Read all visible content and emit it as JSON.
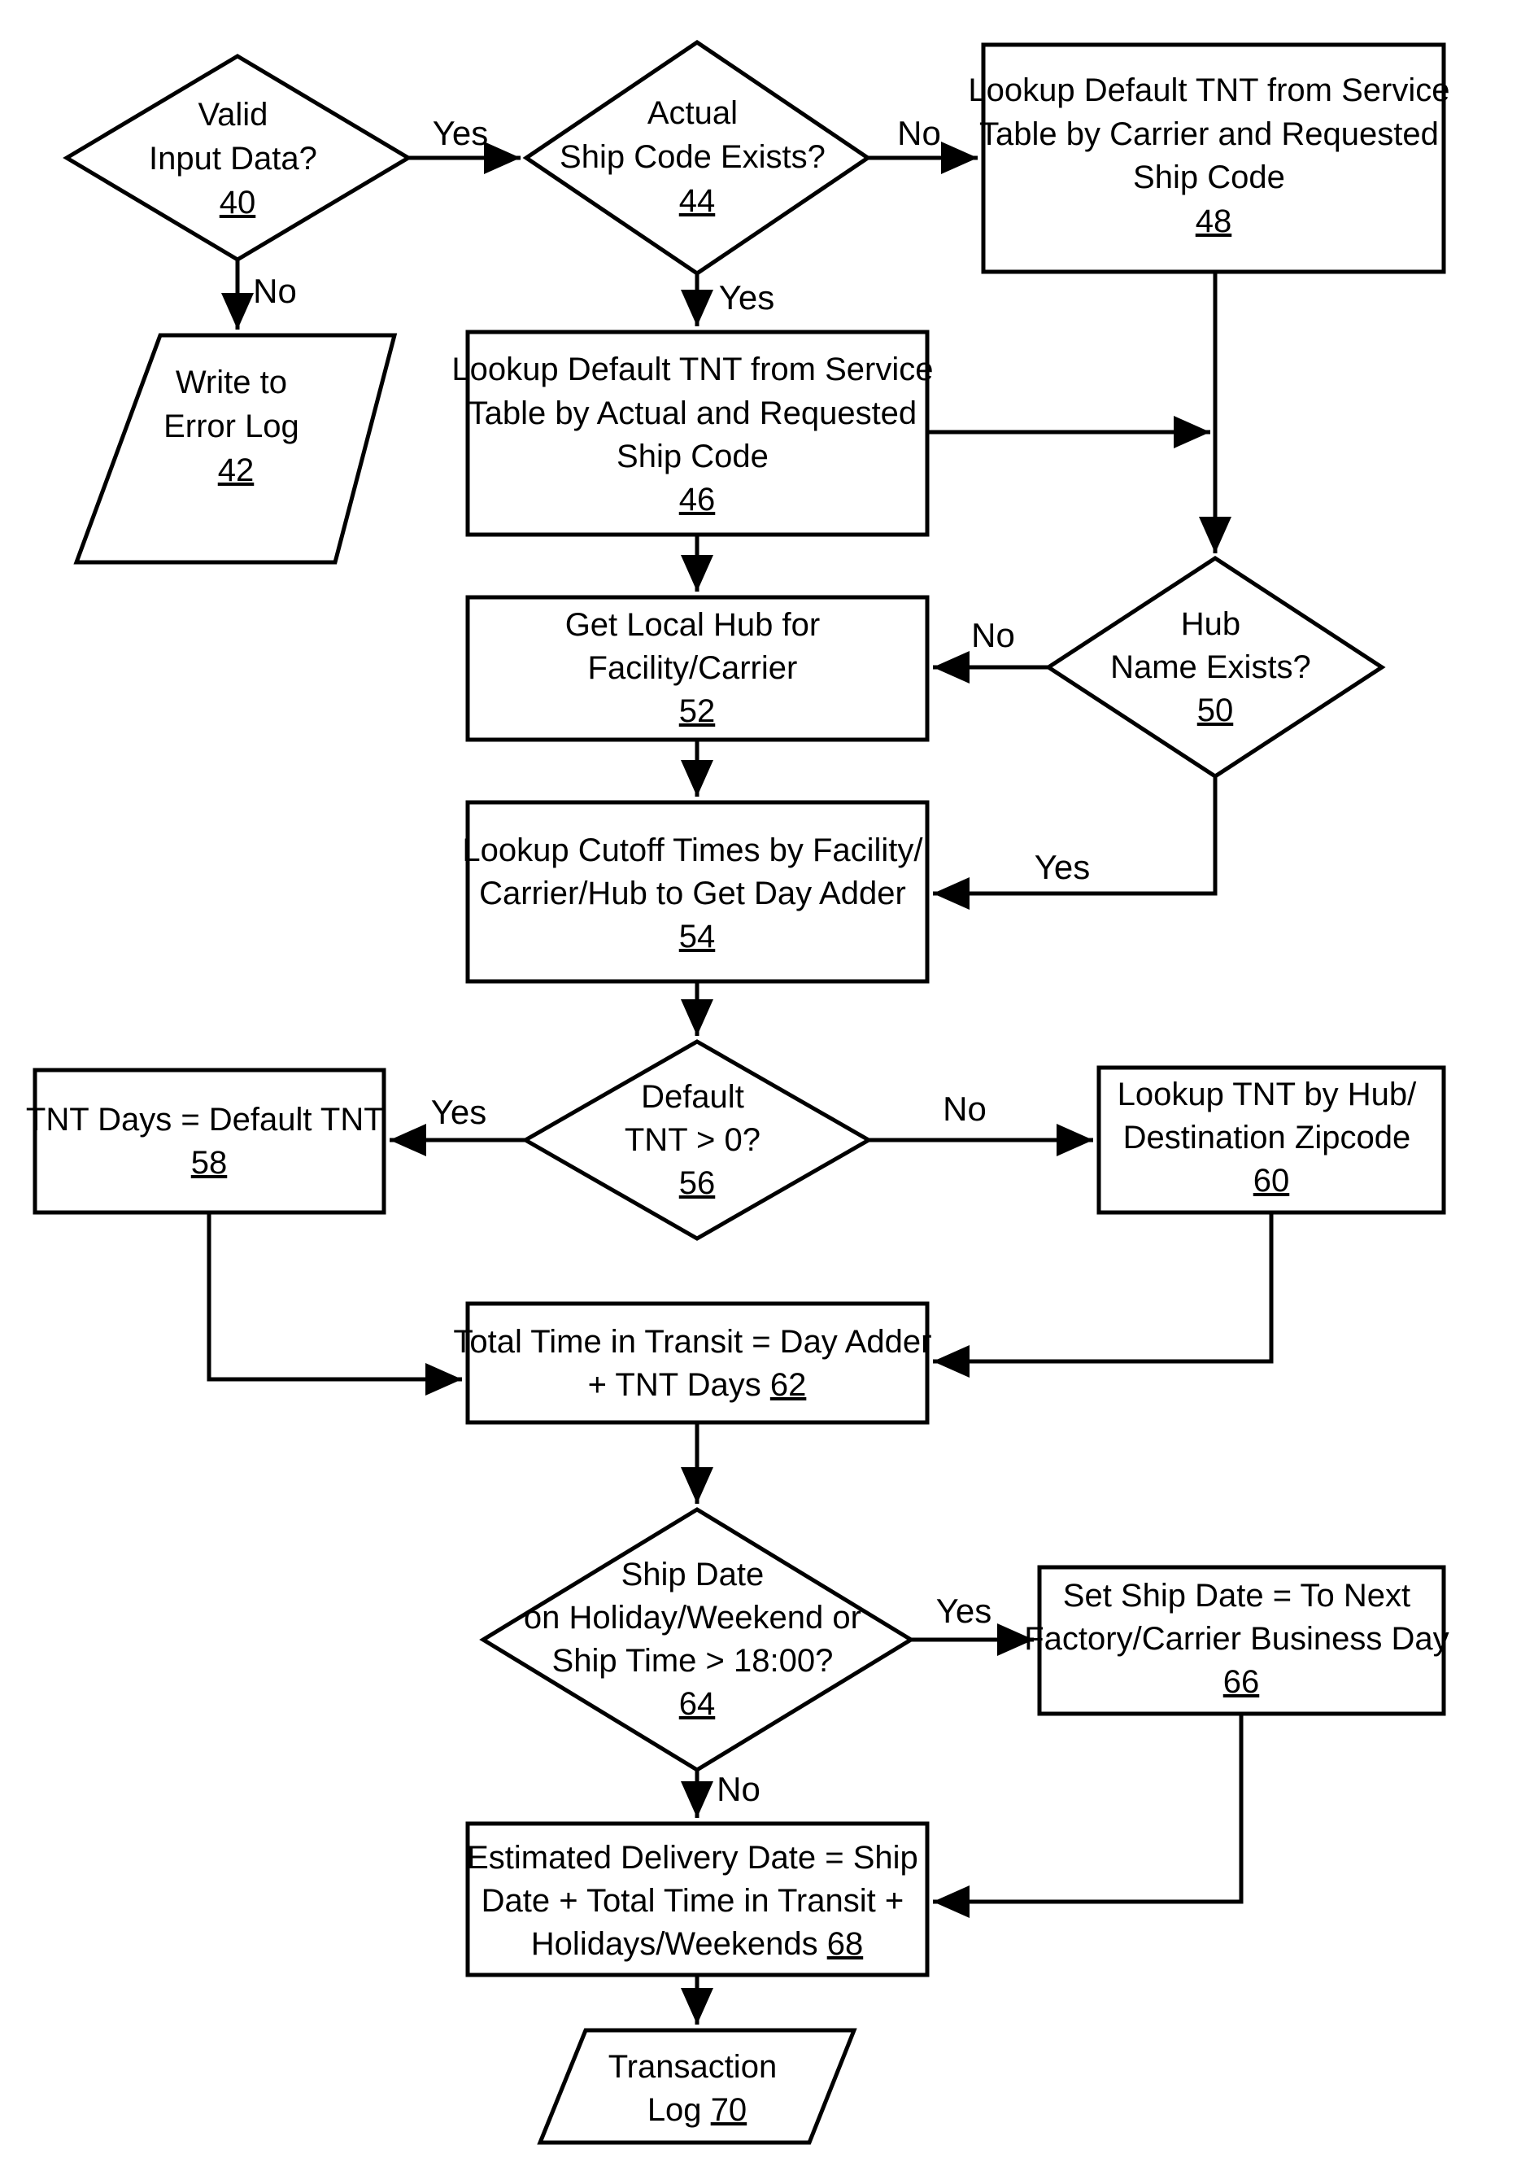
{
  "diagram": {
    "type": "flowchart",
    "nodes": {
      "n40": {
        "shape": "decision",
        "lines": [
          "Valid",
          "Input Data?"
        ],
        "ref": "40"
      },
      "n42": {
        "shape": "io",
        "lines": [
          "Write to",
          "Error Log"
        ],
        "ref": "42"
      },
      "n44": {
        "shape": "decision",
        "lines": [
          "Actual",
          "Ship Code Exists?"
        ],
        "ref": "44"
      },
      "n46": {
        "shape": "process",
        "lines": [
          "Lookup Default TNT from Service",
          "Table by Actual and Requested",
          "Ship Code"
        ],
        "ref": "46"
      },
      "n48": {
        "shape": "process",
        "lines": [
          "Lookup Default TNT from Service",
          "Table by Carrier and Requested",
          "Ship Code"
        ],
        "ref": "48"
      },
      "n50": {
        "shape": "decision",
        "lines": [
          "Hub",
          "Name Exists?"
        ],
        "ref": "50"
      },
      "n52": {
        "shape": "process",
        "lines": [
          "Get Local Hub for",
          "Facility/Carrier"
        ],
        "ref": "52"
      },
      "n54": {
        "shape": "process",
        "lines": [
          "Lookup Cutoff Times by Facility/",
          "Carrier/Hub to Get Day Adder"
        ],
        "ref": "54"
      },
      "n56": {
        "shape": "decision",
        "lines": [
          "Default",
          "TNT > 0?"
        ],
        "ref": "56"
      },
      "n58": {
        "shape": "process",
        "lines": [
          "TNT Days = Default TNT"
        ],
        "ref": "58"
      },
      "n60": {
        "shape": "process",
        "lines": [
          "Lookup TNT by Hub/",
          "Destination Zipcode"
        ],
        "ref": "60"
      },
      "n62": {
        "shape": "process",
        "lines": [
          "Total Time in Transit = Day Adder",
          "+ TNT Days"
        ],
        "ref": "62"
      },
      "n64": {
        "shape": "decision",
        "lines": [
          "Ship Date",
          "on Holiday/Weekend or",
          "Ship Time > 18:00?"
        ],
        "ref": "64"
      },
      "n66": {
        "shape": "process",
        "lines": [
          "Set Ship Date = To Next",
          "Factory/Carrier Business Day"
        ],
        "ref": "66"
      },
      "n68": {
        "shape": "process",
        "lines": [
          "Estimated Delivery Date = Ship",
          "Date + Total Time in Transit +",
          "Holidays/Weekends"
        ],
        "ref": "68"
      },
      "n70": {
        "shape": "io",
        "lines": [
          "Transaction",
          "Log"
        ],
        "ref": "70"
      }
    },
    "edges": [
      {
        "from": "40",
        "to": "44",
        "label": "Yes"
      },
      {
        "from": "40",
        "to": "42",
        "label": "No"
      },
      {
        "from": "44",
        "to": "48",
        "label": "No"
      },
      {
        "from": "44",
        "to": "46",
        "label": "Yes"
      },
      {
        "from": "46",
        "to": "50",
        "label": ""
      },
      {
        "from": "48",
        "to": "50",
        "label": ""
      },
      {
        "from": "46",
        "to": "52",
        "label": ""
      },
      {
        "from": "50",
        "to": "52",
        "label": "No"
      },
      {
        "from": "50",
        "to": "54",
        "label": "Yes"
      },
      {
        "from": "52",
        "to": "54",
        "label": ""
      },
      {
        "from": "54",
        "to": "56",
        "label": ""
      },
      {
        "from": "56",
        "to": "58",
        "label": "Yes"
      },
      {
        "from": "56",
        "to": "60",
        "label": "No"
      },
      {
        "from": "58",
        "to": "62",
        "label": ""
      },
      {
        "from": "60",
        "to": "62",
        "label": ""
      },
      {
        "from": "62",
        "to": "64",
        "label": ""
      },
      {
        "from": "64",
        "to": "66",
        "label": "Yes"
      },
      {
        "from": "64",
        "to": "68",
        "label": "No"
      },
      {
        "from": "66",
        "to": "68",
        "label": ""
      },
      {
        "from": "68",
        "to": "70",
        "label": ""
      }
    ],
    "edge_labels": {
      "yes": "Yes",
      "no": "No"
    }
  }
}
